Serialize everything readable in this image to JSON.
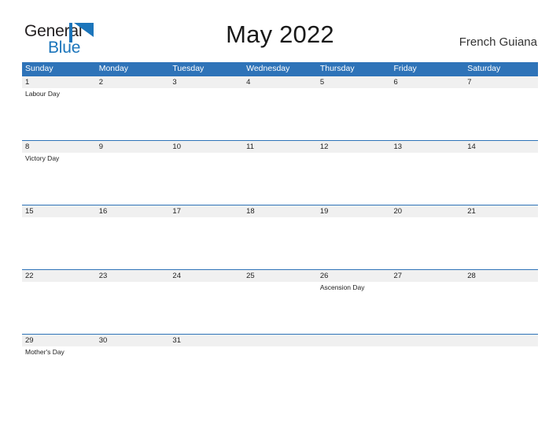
{
  "brand": {
    "name_part1": "General",
    "name_part2": "Blue",
    "flag_color": "#1b75bb",
    "text_color": "#231f20"
  },
  "header": {
    "month_title": "May 2022",
    "region": "French Guiana"
  },
  "calendar": {
    "accent_color": "#2e73b8",
    "date_band_color": "#f0f0f0",
    "weekdays": [
      "Sunday",
      "Monday",
      "Tuesday",
      "Wednesday",
      "Thursday",
      "Friday",
      "Saturday"
    ],
    "weeks": [
      {
        "days": [
          {
            "date": "1",
            "events": [
              "Labour Day"
            ]
          },
          {
            "date": "2",
            "events": []
          },
          {
            "date": "3",
            "events": []
          },
          {
            "date": "4",
            "events": []
          },
          {
            "date": "5",
            "events": []
          },
          {
            "date": "6",
            "events": []
          },
          {
            "date": "7",
            "events": []
          }
        ]
      },
      {
        "days": [
          {
            "date": "8",
            "events": [
              "Victory Day"
            ]
          },
          {
            "date": "9",
            "events": []
          },
          {
            "date": "10",
            "events": []
          },
          {
            "date": "11",
            "events": []
          },
          {
            "date": "12",
            "events": []
          },
          {
            "date": "13",
            "events": []
          },
          {
            "date": "14",
            "events": []
          }
        ]
      },
      {
        "days": [
          {
            "date": "15",
            "events": []
          },
          {
            "date": "16",
            "events": []
          },
          {
            "date": "17",
            "events": []
          },
          {
            "date": "18",
            "events": []
          },
          {
            "date": "19",
            "events": []
          },
          {
            "date": "20",
            "events": []
          },
          {
            "date": "21",
            "events": []
          }
        ]
      },
      {
        "days": [
          {
            "date": "22",
            "events": []
          },
          {
            "date": "23",
            "events": []
          },
          {
            "date": "24",
            "events": []
          },
          {
            "date": "25",
            "events": []
          },
          {
            "date": "26",
            "events": [
              "Ascension Day"
            ]
          },
          {
            "date": "27",
            "events": []
          },
          {
            "date": "28",
            "events": []
          }
        ]
      },
      {
        "days": [
          {
            "date": "29",
            "events": [
              "Mother's Day"
            ]
          },
          {
            "date": "30",
            "events": []
          },
          {
            "date": "31",
            "events": []
          },
          {
            "date": "",
            "events": []
          },
          {
            "date": "",
            "events": []
          },
          {
            "date": "",
            "events": []
          },
          {
            "date": "",
            "events": []
          }
        ]
      }
    ]
  }
}
